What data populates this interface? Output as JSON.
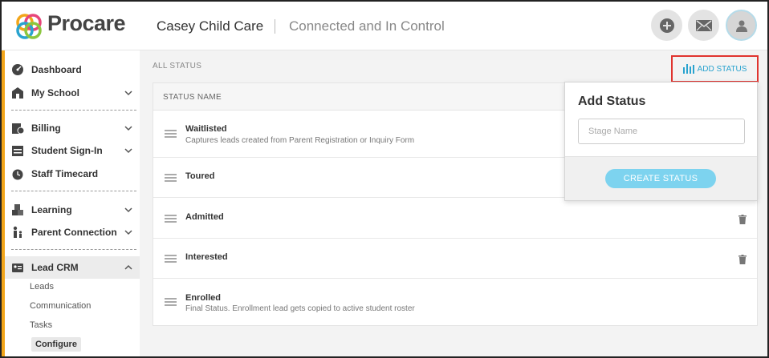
{
  "header": {
    "brand": "Procare",
    "organization": "Casey Child Care",
    "tagline": "Connected and In Control",
    "actions": [
      {
        "icon": "plus-icon"
      },
      {
        "icon": "mail-icon"
      },
      {
        "icon": "user-icon"
      }
    ]
  },
  "sidebar": {
    "items": [
      {
        "label": "Dashboard",
        "icon": "dashboard-icon"
      },
      {
        "label": "My School",
        "icon": "school-icon"
      },
      {
        "label": "Billing",
        "icon": "billing-icon"
      },
      {
        "label": "Student Sign-In",
        "icon": "sign-in-icon"
      },
      {
        "label": "Staff Timecard",
        "icon": "timecard-icon"
      },
      {
        "label": "Learning",
        "icon": "learning-icon"
      },
      {
        "label": "Parent Connection",
        "icon": "parent-icon"
      },
      {
        "label": "Lead CRM",
        "icon": "crm-icon"
      }
    ],
    "subitems": [
      {
        "label": "Leads"
      },
      {
        "label": "Communication"
      },
      {
        "label": "Tasks"
      },
      {
        "label": "Configure"
      }
    ]
  },
  "main": {
    "section_title": "ALL STATUS",
    "add_status_label": "ADD STATUS",
    "column_header": "STATUS NAME",
    "rows": [
      {
        "name": "Waitlisted",
        "description": "Captures leads created from Parent Registration or Inquiry Form"
      },
      {
        "name": "Toured",
        "description": ""
      },
      {
        "name": "Admitted",
        "description": ""
      },
      {
        "name": "Interested",
        "description": ""
      },
      {
        "name": "Enrolled",
        "description": "Final Status. Enrollment lead gets copied to active student roster"
      }
    ]
  },
  "popover": {
    "title": "Add Status",
    "input_placeholder": "Stage Name",
    "input_value": "",
    "button_label": "CREATE STATUS"
  },
  "colors": {
    "accent": "#29a3cf",
    "sidebar_stripe": "#f2a51a",
    "highlight_border": "#e0342f",
    "button": "#7dd3ef"
  }
}
